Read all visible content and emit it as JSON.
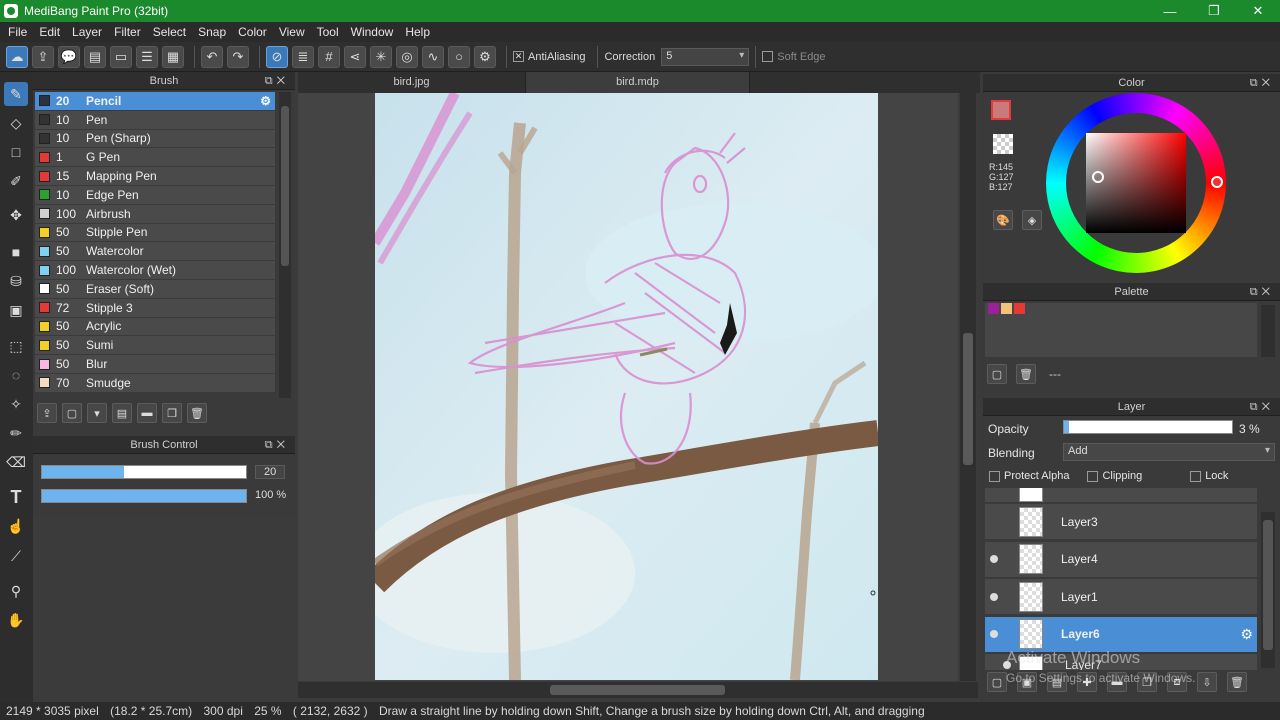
{
  "window": {
    "title": "MediBang Paint Pro (32bit)",
    "controls": [
      "—",
      "❐",
      "✕"
    ]
  },
  "menu": [
    "File",
    "Edit",
    "Layer",
    "Filter",
    "Select",
    "Snap",
    "Color",
    "View",
    "Tool",
    "Window",
    "Help"
  ],
  "toolbar": {
    "antialiasing_label": "AntiAliasing",
    "correction_label": "Correction",
    "correction_value": "5",
    "soft_edge_label": "Soft Edge"
  },
  "brush_panel": {
    "title": "Brush",
    "brushes": [
      {
        "size": "20",
        "name": "Pencil",
        "color": "#2b3340",
        "selected": true
      },
      {
        "size": "10",
        "name": "Pen",
        "color": "#333333"
      },
      {
        "size": "10",
        "name": "Pen (Sharp)",
        "color": "#333333"
      },
      {
        "size": "1",
        "name": "G Pen",
        "color": "#e53935"
      },
      {
        "size": "15",
        "name": "Mapping Pen",
        "color": "#e53935"
      },
      {
        "size": "10",
        "name": "Edge Pen",
        "color": "#2e9e2e"
      },
      {
        "size": "100",
        "name": "Airbrush",
        "color": "#d0d0d0"
      },
      {
        "size": "50",
        "name": "Stipple Pen",
        "color": "#f2d024"
      },
      {
        "size": "50",
        "name": "Watercolor",
        "color": "#7fd3f0"
      },
      {
        "size": "100",
        "name": "Watercolor (Wet)",
        "color": "#7fd3f0"
      },
      {
        "size": "50",
        "name": "Eraser (Soft)",
        "color": "#ffffff"
      },
      {
        "size": "72",
        "name": "Stipple 3",
        "color": "#e53935"
      },
      {
        "size": "50",
        "name": "Acrylic",
        "color": "#f2d024"
      },
      {
        "size": "50",
        "name": "Sumi",
        "color": "#f2d024"
      },
      {
        "size": "50",
        "name": "Blur",
        "color": "#f7b8e8"
      },
      {
        "size": "70",
        "name": "Smudge",
        "color": "#f5dcc0"
      }
    ]
  },
  "brush_control": {
    "title": "Brush Control",
    "size_value": "20",
    "opacity_value": "100 %",
    "size_fraction": 0.4,
    "opacity_fraction": 1.0
  },
  "tabs": [
    {
      "label": "bird.jpg",
      "active": false
    },
    {
      "label": "bird.mdp",
      "active": true
    }
  ],
  "color_panel": {
    "title": "Color",
    "r": "R:145",
    "g": "G:127",
    "b": "B:127",
    "primary": "#917f7f"
  },
  "palette_panel": {
    "title": "Palette",
    "swatches": [
      "#9c1f9c",
      "#f2c27a",
      "#e53935"
    ],
    "footer_text": "---"
  },
  "layer_panel": {
    "title": "Layer",
    "opacity_label": "Opacity",
    "opacity_value": "3 %",
    "blending_label": "Blending",
    "blending_value": "Add",
    "protect_alpha": "Protect Alpha",
    "clipping": "Clipping",
    "lock": "Lock",
    "layers": [
      {
        "name": "Layer3",
        "visible": false,
        "selected": false
      },
      {
        "name": "Layer4",
        "visible": true,
        "selected": false
      },
      {
        "name": "Layer1",
        "visible": true,
        "selected": false
      },
      {
        "name": "Layer6",
        "visible": true,
        "selected": true
      }
    ],
    "partial_top_label": "",
    "partial_bottom_label": "Layer7"
  },
  "watermark": {
    "line1": "Activate Windows",
    "line2": "Go to Settings to activate Windows."
  },
  "status": {
    "dimensions": "2149 * 3035 pixel",
    "cm": "(18.2 * 25.7cm)",
    "dpi": "300 dpi",
    "zoom": "25 %",
    "coords": "( 2132, 2632 )",
    "hint": "Draw a straight line by holding down Shift, Change a brush size by holding down Ctrl, Alt, and dragging"
  }
}
